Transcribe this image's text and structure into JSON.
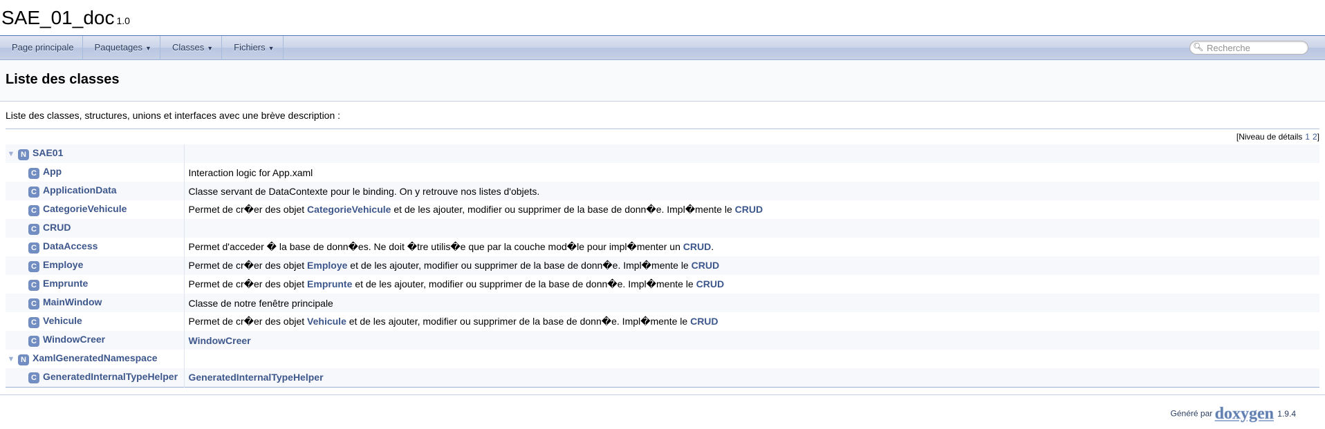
{
  "project": {
    "name": "SAE_01_doc",
    "number": "1.0"
  },
  "nav": {
    "items": [
      {
        "label": "Page principale",
        "has_caret": false
      },
      {
        "label": "Paquetages",
        "has_caret": true
      },
      {
        "label": "Classes",
        "has_caret": true
      },
      {
        "label": "Fichiers",
        "has_caret": true
      }
    ],
    "search_placeholder": "Recherche"
  },
  "header": {
    "title": "Liste des classes"
  },
  "intro": "Liste des classes, structures, unions et interfaces avec une brève description :",
  "levels": {
    "label": "[Niveau de détails",
    "links": [
      "1",
      "2"
    ],
    "close": "]"
  },
  "rows": [
    {
      "level": 0,
      "icon": "N",
      "name": "SAE01",
      "arrow": "▼",
      "desc": []
    },
    {
      "level": 1,
      "icon": "C",
      "name": "App",
      "desc": [
        {
          "t": "Interaction logic for App.xaml"
        }
      ]
    },
    {
      "level": 1,
      "icon": "C",
      "name": "ApplicationData",
      "desc": [
        {
          "t": "Classe servant de DataContexte pour le binding. On y retrouve nos listes d'objets."
        }
      ]
    },
    {
      "level": 1,
      "icon": "C",
      "name": "CategorieVehicule",
      "desc": [
        {
          "t": "Permet de cr�er des objet "
        },
        {
          "l": "CategorieVehicule"
        },
        {
          "t": " et de les ajouter, modifier ou supprimer de la base de donn�e. Impl�mente le "
        },
        {
          "l": "CRUD"
        }
      ]
    },
    {
      "level": 1,
      "icon": "C",
      "name": "CRUD",
      "desc": []
    },
    {
      "level": 1,
      "icon": "C",
      "name": "DataAccess",
      "desc": [
        {
          "t": "Permet d'acceder � la base de donn�es. Ne doit �tre utilis�e que par la couche mod�le pour impl�menter un "
        },
        {
          "l": "CRUD"
        },
        {
          "t": "."
        }
      ]
    },
    {
      "level": 1,
      "icon": "C",
      "name": "Employe",
      "desc": [
        {
          "t": "Permet de cr�er des objet "
        },
        {
          "l": "Employe"
        },
        {
          "t": " et de les ajouter, modifier ou supprimer de la base de donn�e. Impl�mente le "
        },
        {
          "l": "CRUD"
        }
      ]
    },
    {
      "level": 1,
      "icon": "C",
      "name": "Emprunte",
      "desc": [
        {
          "t": "Permet de cr�er des objet "
        },
        {
          "l": "Emprunte"
        },
        {
          "t": " et de les ajouter, modifier ou supprimer de la base de donn�e. Impl�mente le "
        },
        {
          "l": "CRUD"
        }
      ]
    },
    {
      "level": 1,
      "icon": "C",
      "name": "MainWindow",
      "desc": [
        {
          "t": "Classe de notre fenêtre principale"
        }
      ]
    },
    {
      "level": 1,
      "icon": "C",
      "name": "Vehicule",
      "desc": [
        {
          "t": "Permet de cr�er des objet "
        },
        {
          "l": "Vehicule"
        },
        {
          "t": " et de les ajouter, modifier ou supprimer de la base de donn�e. Impl�mente le "
        },
        {
          "l": "CRUD"
        }
      ]
    },
    {
      "level": 1,
      "icon": "C",
      "name": "WindowCreer",
      "desc": [
        {
          "l": "WindowCreer"
        }
      ]
    },
    {
      "level": 0,
      "icon": "N",
      "name": "XamlGeneratedNamespace",
      "arrow": "▼",
      "desc": []
    },
    {
      "level": 1,
      "icon": "C",
      "name": "GeneratedInternalTypeHelper",
      "desc": [
        {
          "l": "GeneratedInternalTypeHelper"
        }
      ]
    }
  ],
  "footer": {
    "generated_by": "Généré par",
    "logo": "doxygen",
    "version": "1.9.4"
  },
  "colors": {
    "link": "#3d578c",
    "icon_bg": "#728dc1",
    "nav_border": "#5373b4"
  }
}
